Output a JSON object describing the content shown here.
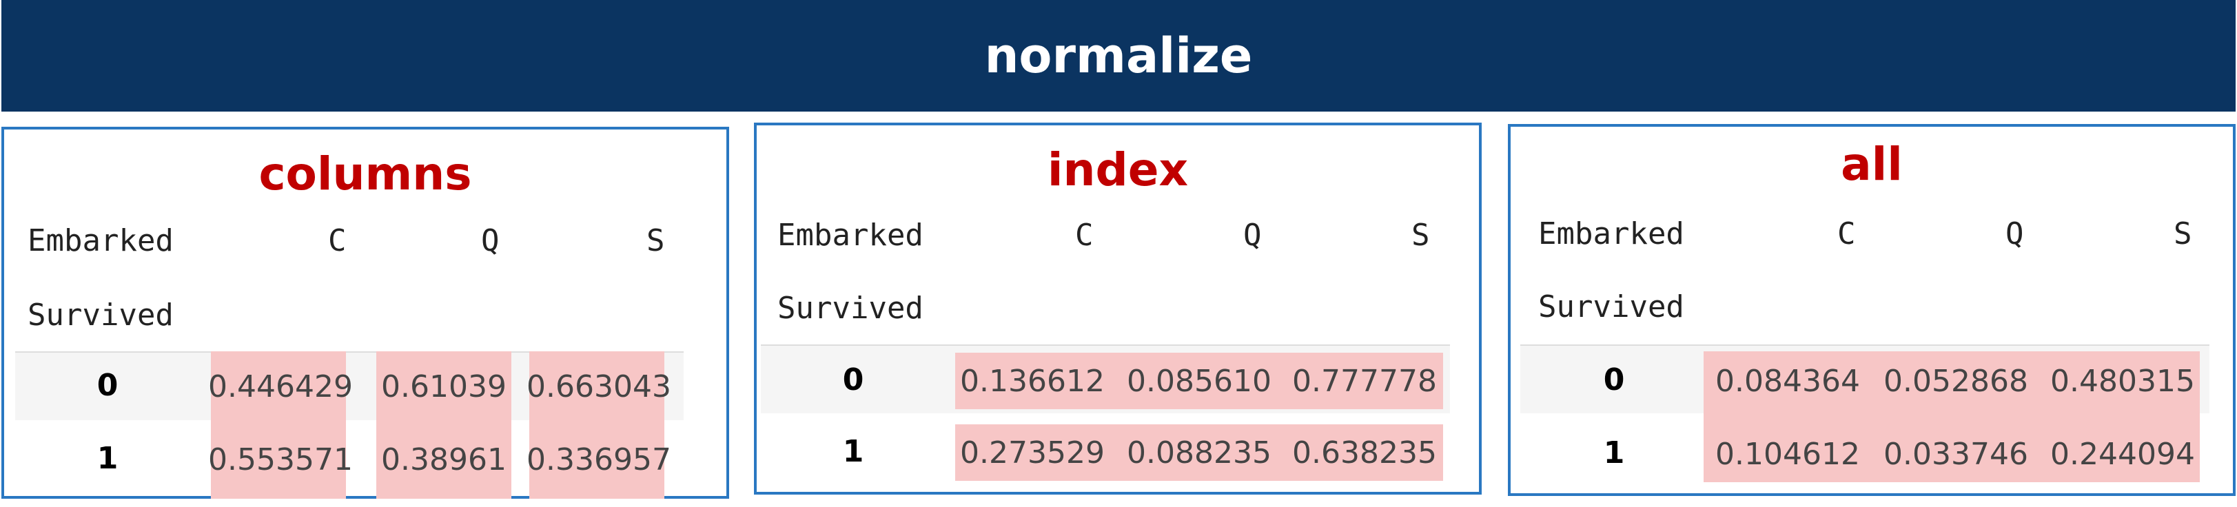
{
  "banner": {
    "title": "normalize"
  },
  "index_label": "Embarked",
  "row_label": "Survived",
  "column_labels": [
    "C",
    "Q",
    "S"
  ],
  "row_indices": [
    "0",
    "1"
  ],
  "panels": [
    {
      "title": "columns",
      "rows": [
        [
          "0.446429",
          "0.61039",
          "0.663043"
        ],
        [
          "0.553571",
          "0.38961",
          "0.336957"
        ]
      ]
    },
    {
      "title": "index",
      "rows": [
        [
          "0.136612",
          "0.085610",
          "0.777778"
        ],
        [
          "0.273529",
          "0.088235",
          "0.638235"
        ]
      ]
    },
    {
      "title": "all",
      "rows": [
        [
          "0.084364",
          "0.052868",
          "0.480315"
        ],
        [
          "0.104612",
          "0.033746",
          "0.244094"
        ]
      ]
    }
  ],
  "colors": {
    "banner_bg": "#0b3461",
    "panel_border": "#2a78c2",
    "title_red": "#c00000",
    "highlight": "#f7c6c6"
  }
}
